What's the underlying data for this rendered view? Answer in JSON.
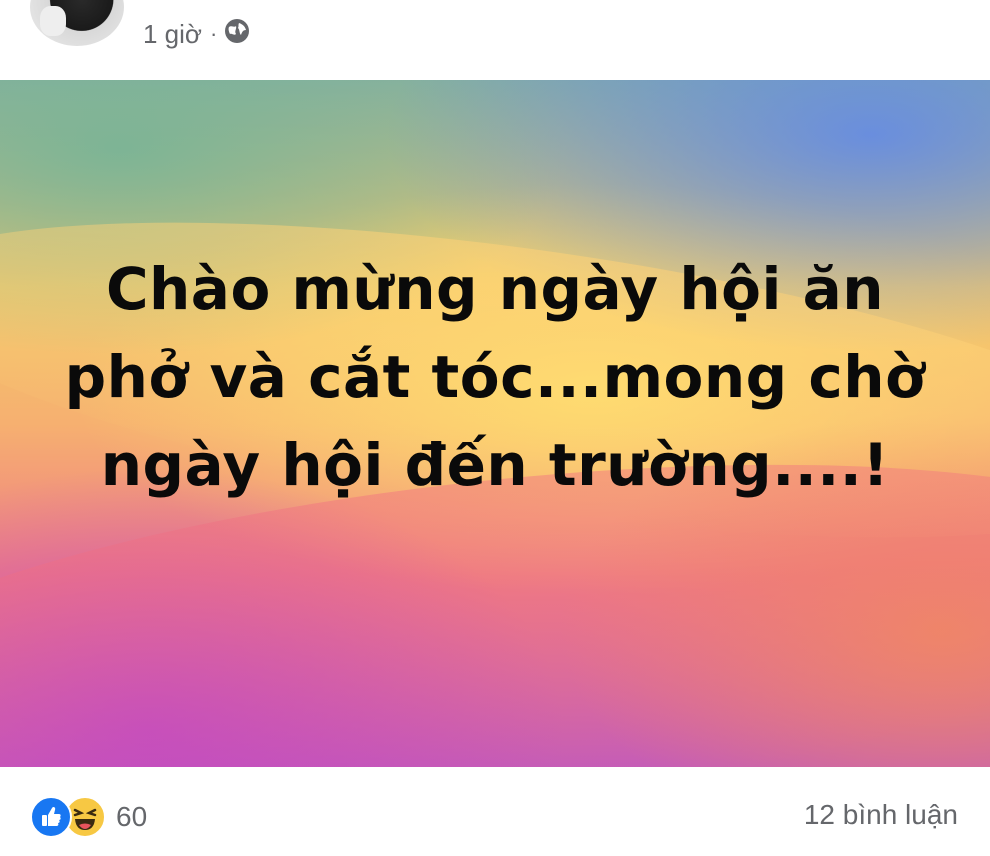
{
  "header": {
    "time": "1 giờ",
    "separator": "·",
    "privacy_icon": "globe-icon"
  },
  "post": {
    "text": "Chào mừng ngày hội ăn phở và cắt tóc...mong chờ ngày hội đến trường....!"
  },
  "footer": {
    "reaction_icons": [
      "like-icon",
      "haha-icon"
    ],
    "reaction_count": "60",
    "comments": "12 bình luận"
  },
  "colors": {
    "meta_text": "#65676b",
    "like_blue": "#1877f2",
    "haha_yellow": "#f7c843",
    "post_text": "#0a0a0a"
  }
}
